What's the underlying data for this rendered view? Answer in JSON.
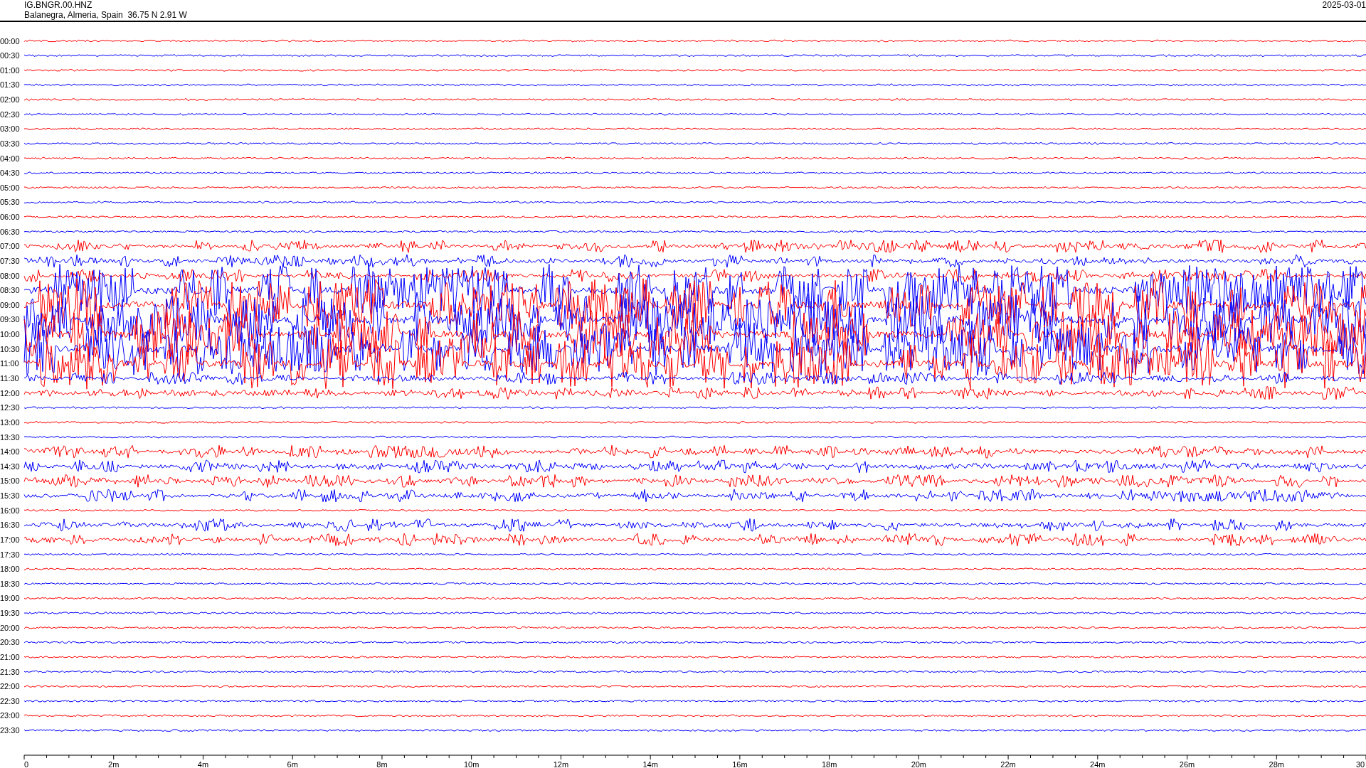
{
  "header": {
    "station": "IG.BNGR.00.HNZ",
    "location": "Balanegra, Almeria, Spain  36.75 N 2.91 W",
    "date": "2025-03-01"
  },
  "traces": [
    {
      "label": "00:00",
      "color": "#ff0000",
      "kind": "quiet"
    },
    {
      "label": "00:30",
      "color": "#0000ff",
      "kind": "quiet"
    },
    {
      "label": "01:00",
      "color": "#ff0000",
      "kind": "quiet"
    },
    {
      "label": "01:30",
      "color": "#0000ff",
      "kind": "quiet"
    },
    {
      "label": "02:00",
      "color": "#ff0000",
      "kind": "quiet"
    },
    {
      "label": "02:30",
      "color": "#0000ff",
      "kind": "quiet"
    },
    {
      "label": "03:00",
      "color": "#ff0000",
      "kind": "quiet"
    },
    {
      "label": "03:30",
      "color": "#0000ff",
      "kind": "quiet"
    },
    {
      "label": "04:00",
      "color": "#ff0000",
      "kind": "quiet"
    },
    {
      "label": "04:30",
      "color": "#0000ff",
      "kind": "quiet"
    },
    {
      "label": "05:00",
      "color": "#ff0000",
      "kind": "quiet"
    },
    {
      "label": "05:30",
      "color": "#0000ff",
      "kind": "quiet"
    },
    {
      "label": "06:00",
      "color": "#ff0000",
      "kind": "quiet"
    },
    {
      "label": "06:30",
      "color": "#0000ff",
      "kind": "quiet"
    },
    {
      "label": "07:00",
      "color": "#ff0000",
      "kind": "noisy"
    },
    {
      "label": "07:30",
      "color": "#0000ff",
      "kind": "noisy"
    },
    {
      "label": "08:00",
      "color": "#ff0000",
      "kind": "noisy"
    },
    {
      "label": "08:30",
      "color": "#0000ff",
      "kind": "busy"
    },
    {
      "label": "09:00",
      "color": "#ff0000",
      "kind": "busy"
    },
    {
      "label": "09:30",
      "color": "#0000ff",
      "kind": "busy"
    },
    {
      "label": "10:00",
      "color": "#ff0000",
      "kind": "busy"
    },
    {
      "label": "10:30",
      "color": "#0000ff",
      "kind": "busy"
    },
    {
      "label": "11:00",
      "color": "#ff0000",
      "kind": "busy"
    },
    {
      "label": "11:30",
      "color": "#0000ff",
      "kind": "noisy"
    },
    {
      "label": "12:00",
      "color": "#ff0000",
      "kind": "noisy"
    },
    {
      "label": "12:30",
      "color": "#0000ff",
      "kind": "quiet"
    },
    {
      "label": "13:00",
      "color": "#ff0000",
      "kind": "quiet"
    },
    {
      "label": "13:30",
      "color": "#0000ff",
      "kind": "quiet"
    },
    {
      "label": "14:00",
      "color": "#ff0000",
      "kind": "noisy"
    },
    {
      "label": "14:30",
      "color": "#0000ff",
      "kind": "noisy"
    },
    {
      "label": "15:00",
      "color": "#ff0000",
      "kind": "noisy"
    },
    {
      "label": "15:30",
      "color": "#0000ff",
      "kind": "noisy"
    },
    {
      "label": "16:00",
      "color": "#ff0000",
      "kind": "quiet"
    },
    {
      "label": "16:30",
      "color": "#0000ff",
      "kind": "noisy"
    },
    {
      "label": "17:00",
      "color": "#ff0000",
      "kind": "noisy"
    },
    {
      "label": "17:30",
      "color": "#0000ff",
      "kind": "quiet"
    },
    {
      "label": "18:00",
      "color": "#ff0000",
      "kind": "quiet"
    },
    {
      "label": "18:30",
      "color": "#0000ff",
      "kind": "quiet"
    },
    {
      "label": "19:00",
      "color": "#ff0000",
      "kind": "quiet"
    },
    {
      "label": "19:30",
      "color": "#0000ff",
      "kind": "quiet"
    },
    {
      "label": "20:00",
      "color": "#ff0000",
      "kind": "quiet"
    },
    {
      "label": "20:30",
      "color": "#0000ff",
      "kind": "quiet"
    },
    {
      "label": "21:00",
      "color": "#ff0000",
      "kind": "quiet"
    },
    {
      "label": "21:30",
      "color": "#0000ff",
      "kind": "quiet"
    },
    {
      "label": "22:00",
      "color": "#ff0000",
      "kind": "quiet"
    },
    {
      "label": "22:30",
      "color": "#0000ff",
      "kind": "quiet"
    },
    {
      "label": "23:00",
      "color": "#ff0000",
      "kind": "quiet"
    },
    {
      "label": "23:30",
      "color": "#0000ff",
      "kind": "quiet"
    }
  ],
  "x_axis": {
    "ticks": [
      "0",
      "2m",
      "4m",
      "6m",
      "8m",
      "10m",
      "12m",
      "14m",
      "16m",
      "18m",
      "20m",
      "22m",
      "24m",
      "26m",
      "28m",
      "30"
    ]
  }
}
